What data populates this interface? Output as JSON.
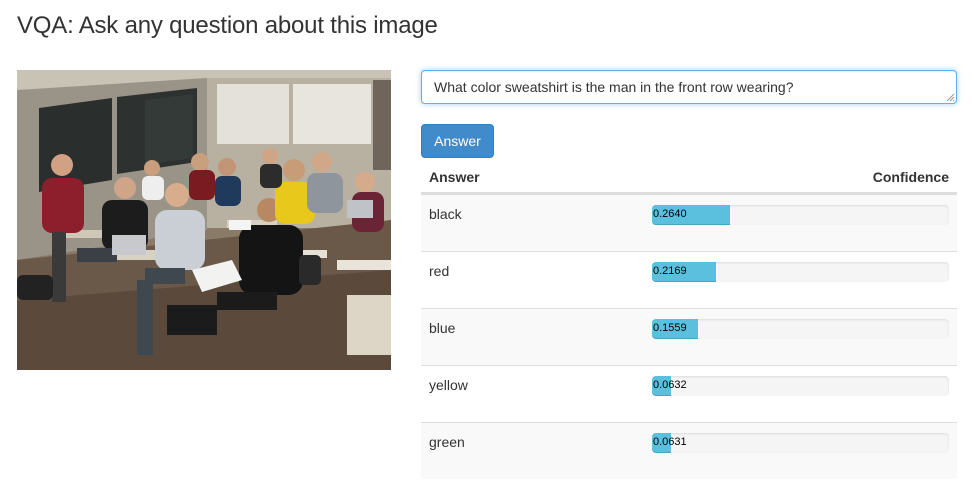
{
  "page": {
    "title": "VQA: Ask any question about this image"
  },
  "question": {
    "value": "What color sweatshirt is the man in the front row wearing?"
  },
  "answer_button_label": "Answer",
  "results": {
    "header_answer": "Answer",
    "header_confidence": "Confidence",
    "rows": [
      {
        "answer": "black",
        "confidence_text": "0.2640",
        "confidence": 0.264
      },
      {
        "answer": "red",
        "confidence_text": "0.2169",
        "confidence": 0.2169
      },
      {
        "answer": "blue",
        "confidence_text": "0.1559",
        "confidence": 0.1559
      },
      {
        "answer": "yellow",
        "confidence_text": "0.0632",
        "confidence": 0.0632
      },
      {
        "answer": "green",
        "confidence_text": "0.0631",
        "confidence": 0.0631
      }
    ]
  },
  "colors": {
    "button": "#428bca",
    "bar": "#5bc0de",
    "focus_border": "#66afe9"
  },
  "icons": {
    "resize": "resize-grip-icon"
  }
}
